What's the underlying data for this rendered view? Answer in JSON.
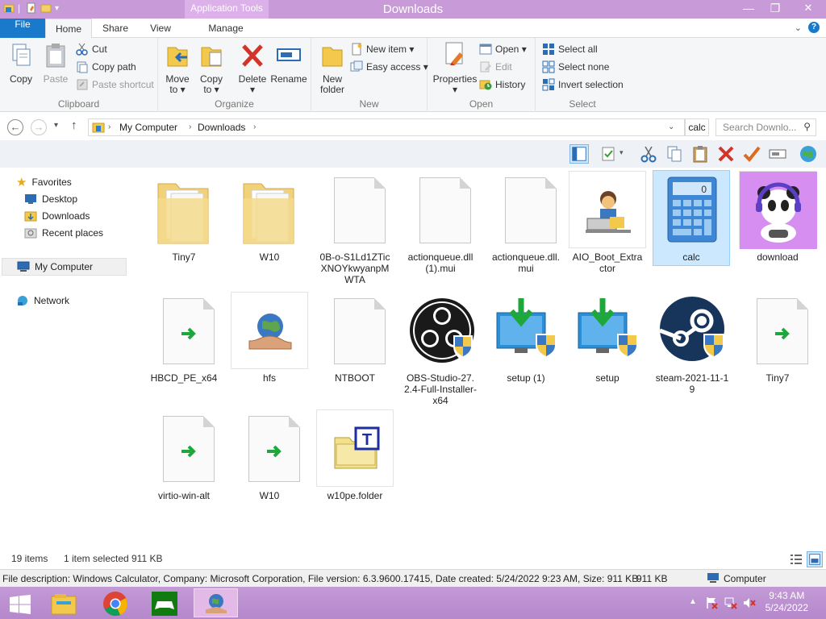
{
  "window": {
    "title": "Downloads",
    "context_tab": "Application Tools",
    "controls": {
      "minimize": "—",
      "restore": "❐",
      "close": "✕"
    }
  },
  "tabs": {
    "file": "File",
    "home": "Home",
    "share": "Share",
    "view": "View",
    "manage": "Manage"
  },
  "ribbon": {
    "clipboard": {
      "label": "Clipboard",
      "copy": "Copy",
      "paste": "Paste",
      "cut": "Cut",
      "copy_path": "Copy path",
      "paste_shortcut": "Paste shortcut"
    },
    "organize": {
      "label": "Organize",
      "move_to": [
        "Move",
        "to ▾"
      ],
      "copy_to": [
        "Copy",
        "to ▾"
      ],
      "delete": [
        "Delete",
        "▾"
      ],
      "rename": "Rename"
    },
    "new": {
      "label": "New",
      "new_folder": [
        "New",
        "folder"
      ],
      "new_item": "New item ▾",
      "easy_access": "Easy access ▾"
    },
    "open": {
      "label": "Open",
      "properties": [
        "Properties",
        "▾"
      ],
      "open": "Open ▾",
      "edit": "Edit",
      "history": "History"
    },
    "select": {
      "label": "Select",
      "select_all": "Select all",
      "select_none": "Select none",
      "invert": "Invert selection"
    }
  },
  "address": {
    "path": [
      "My Computer",
      "Downloads"
    ],
    "current_folder_tag": "calc",
    "search_placeholder": "Search Downlo..."
  },
  "nav": {
    "favorites": "Favorites",
    "desktop": "Desktop",
    "downloads": "Downloads",
    "recent": "Recent places",
    "computer": "My Computer",
    "network": "Network"
  },
  "files": [
    {
      "name": "Tiny7",
      "kind": "folder"
    },
    {
      "name": "W10",
      "kind": "folder"
    },
    {
      "name": "0B-o-S1Ld1ZTicXNOYkwyanpMWTA",
      "kind": "doc"
    },
    {
      "name": "actionqueue.dll (1).mui",
      "kind": "doc"
    },
    {
      "name": "actionqueue.dll.mui",
      "kind": "doc"
    },
    {
      "name": "AIO_Boot_Extractor",
      "kind": "app-aio"
    },
    {
      "name": "calc",
      "kind": "app-calc",
      "selected": true
    },
    {
      "name": "download",
      "kind": "img-panda"
    },
    {
      "name": "HBCD_PE_x64",
      "kind": "shortcut"
    },
    {
      "name": "hfs",
      "kind": "app-hfs"
    },
    {
      "name": "NTBOOT",
      "kind": "doc"
    },
    {
      "name": "OBS-Studio-27.2.4-Full-Installer-x64",
      "kind": "app-obs"
    },
    {
      "name": "setup (1)",
      "kind": "app-setup"
    },
    {
      "name": "setup",
      "kind": "app-setup"
    },
    {
      "name": "steam-2021-11-19",
      "kind": "app-steam"
    },
    {
      "name": "Tiny7",
      "kind": "shortcut"
    },
    {
      "name": "virtio-win-alt",
      "kind": "shortcut"
    },
    {
      "name": "W10",
      "kind": "shortcut"
    },
    {
      "name": "w10pe.folder",
      "kind": "folder-t"
    }
  ],
  "status": {
    "items": "19 items",
    "selected": "1 item selected",
    "size": "911 KB"
  },
  "details": {
    "description": "File description: Windows Calculator, Company: Microsoft Corporation, File version: 6.3.9600.17415, Date created: 5/24/2022 9:23 AM, Size: 911 KB",
    "size": "911 KB",
    "location": "Computer"
  },
  "taskbar": {
    "time": "9:43 AM",
    "date": "5/24/2022"
  },
  "colors": {
    "accent": "#1979ca",
    "titlebar": "#c99ad8",
    "taskbar": "#b98ad0",
    "selection": "#cce8ff"
  }
}
